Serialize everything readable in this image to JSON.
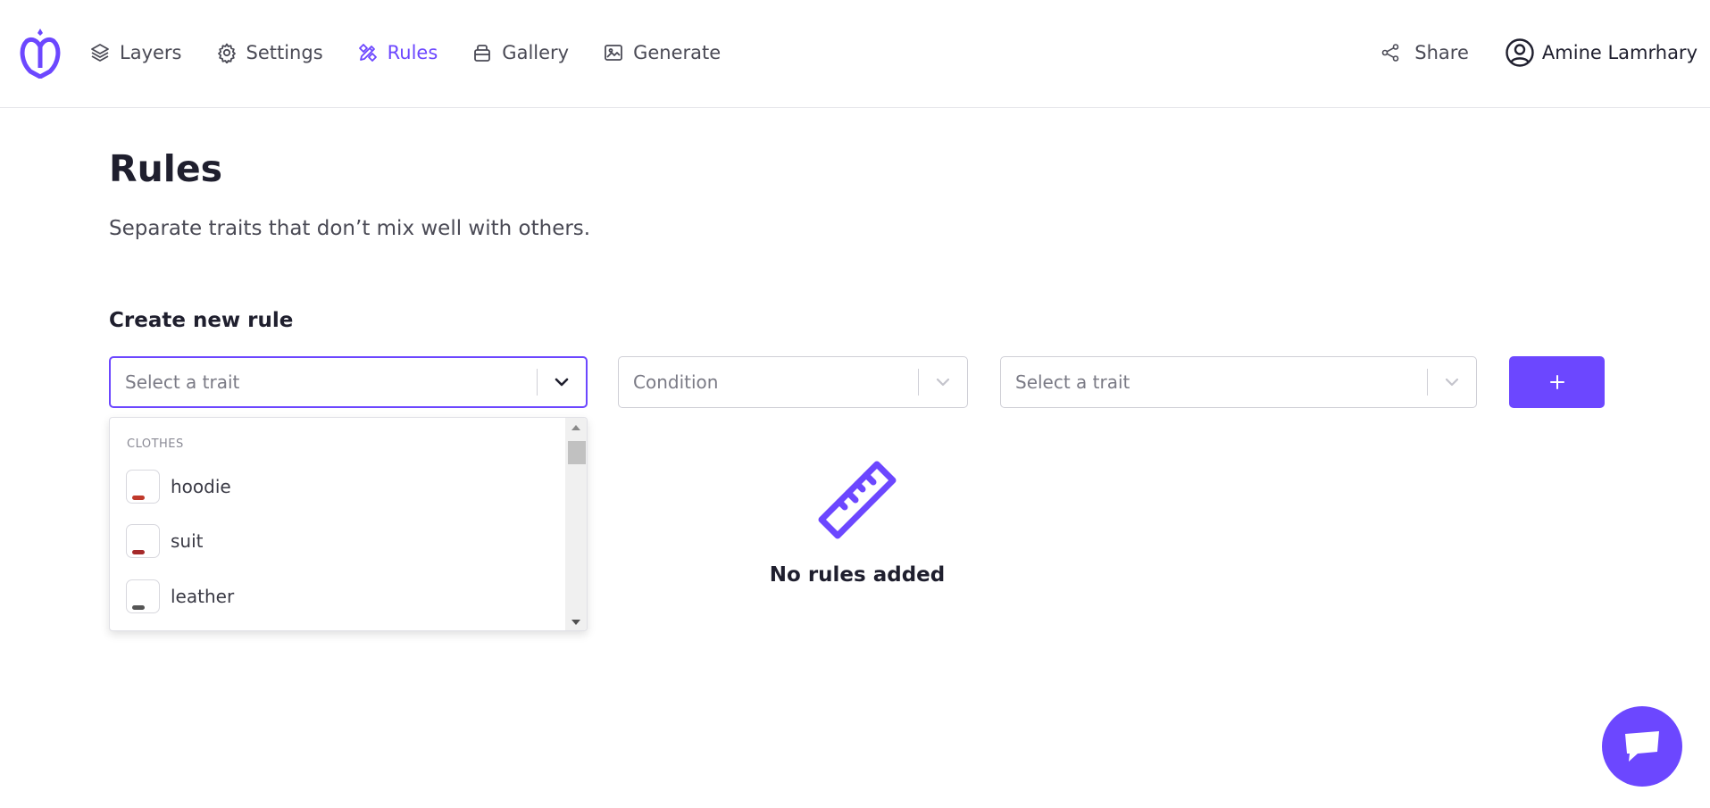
{
  "header": {
    "logo_icon": "brand-logo-icon",
    "nav": [
      {
        "label": "Layers",
        "icon": "layers-icon",
        "active": false
      },
      {
        "label": "Settings",
        "icon": "gear-icon",
        "active": false
      },
      {
        "label": "Rules",
        "icon": "pencil-ruler-icon",
        "active": true
      },
      {
        "label": "Gallery",
        "icon": "gallery-icon",
        "active": false
      },
      {
        "label": "Generate",
        "icon": "image-icon",
        "active": false
      }
    ],
    "share_label": "Share",
    "user_name": "Amine Lamrhary"
  },
  "page": {
    "title": "Rules",
    "subtitle": "Separate traits that don’t mix well with others."
  },
  "create_rule": {
    "title": "Create new rule",
    "trait_select_1": {
      "placeholder": "Select a trait"
    },
    "condition_select": {
      "placeholder": "Condition"
    },
    "trait_select_2": {
      "placeholder": "Select a trait"
    },
    "add_button_icon": "plus-icon"
  },
  "dropdown": {
    "group_label": "CLOTHES",
    "options": [
      {
        "label": "hoodie",
        "color": "#c0392b"
      },
      {
        "label": "suit",
        "color": "#a52a2a"
      },
      {
        "label": "leather",
        "color": "#555555"
      }
    ]
  },
  "empty_state": {
    "icon": "ruler-icon",
    "text": "No rules added"
  },
  "colors": {
    "accent": "#6c47ff",
    "text": "#1f1f2e"
  }
}
